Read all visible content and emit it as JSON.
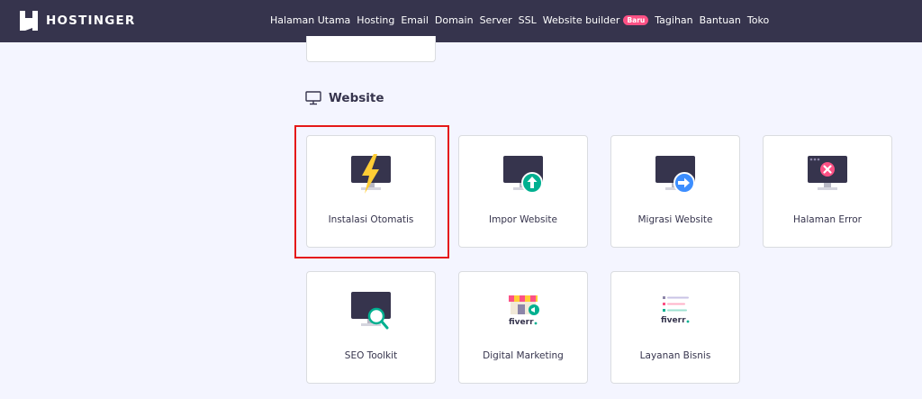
{
  "header": {
    "brand": "HOSTINGER",
    "nav": [
      {
        "label": "Halaman Utama"
      },
      {
        "label": "Hosting"
      },
      {
        "label": "Email"
      },
      {
        "label": "Domain"
      },
      {
        "label": "Server"
      },
      {
        "label": "SSL"
      },
      {
        "label": "Website builder",
        "badge": "Baru"
      },
      {
        "label": "Tagihan"
      },
      {
        "label": "Bantuan"
      },
      {
        "label": "Toko"
      }
    ]
  },
  "section": {
    "title": "Website",
    "icon": "monitor-icon"
  },
  "cards": [
    {
      "label": "Instalasi Otomatis",
      "icon": "lightning-monitor-icon"
    },
    {
      "label": "Impor Website",
      "icon": "upload-monitor-icon"
    },
    {
      "label": "Migrasi Website",
      "icon": "migrate-monitor-icon"
    },
    {
      "label": "Halaman Error",
      "icon": "error-monitor-icon"
    },
    {
      "label": "SEO Toolkit",
      "icon": "seo-monitor-icon"
    },
    {
      "label": "Digital Marketing",
      "icon": "fiverr-marketing-icon",
      "logo": "fiverr"
    },
    {
      "label": "Layanan Bisnis",
      "icon": "fiverr-business-icon",
      "logo": "fiverr"
    }
  ],
  "colors": {
    "header_bg": "#36344d",
    "page_bg": "#f4f5ff",
    "badge": "#fc5185",
    "highlight": "#e51919",
    "bolt": "#ffcd35",
    "green": "#00b090",
    "blue": "#3d8eff",
    "red": "#fc5185"
  }
}
